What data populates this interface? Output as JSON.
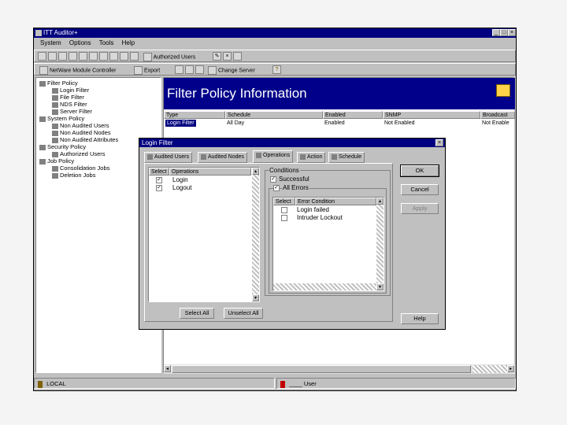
{
  "app": {
    "title": "ITT Auditor+"
  },
  "menu": [
    "System",
    "Options",
    "Tools",
    "Help"
  ],
  "toolbar": {
    "authorized_users": "Authorized Users",
    "netware_module_controller": "NetWare Module Controller",
    "export": "Export",
    "change_server": "Change Server"
  },
  "tree": {
    "items": [
      "Filter Policy",
      "Login Filter",
      "File Filter",
      "NDS Filter",
      "Server Filter",
      "System Policy",
      "Non Audited Users",
      "Non Audited Nodes",
      "Non Audited Attributes",
      "Security Policy",
      "Authorized Users",
      "Job Policy",
      "Consolidation Jobs",
      "Deletion Jobs"
    ]
  },
  "main": {
    "banner": "Filter Policy Information",
    "columns": [
      "Type",
      "Schedule",
      "Enabled",
      "SNMP",
      "Broadcast"
    ],
    "row": [
      "Login Filter",
      "All Day",
      "Enabled",
      "Not Enabled",
      "Not Enable"
    ]
  },
  "status": {
    "server": "LOCAL",
    "user": "____ User"
  },
  "dialog": {
    "title": "Login Filter",
    "tabs": [
      "Audited Users",
      "Audited Nodes",
      "Operations",
      "Action",
      "Schedule"
    ],
    "operations": {
      "headers": [
        "Select",
        "Operations"
      ],
      "items": [
        {
          "label": "Login",
          "checked": true
        },
        {
          "label": "Logout",
          "checked": true
        }
      ]
    },
    "conditions": {
      "group_label": "Conditions",
      "successful": "Successful",
      "successful_checked": true,
      "all_errors": "All Errors",
      "all_errors_checked": true,
      "headers": [
        "Select",
        "Error Condition"
      ],
      "items": [
        {
          "label": "Login failed",
          "checked": false
        },
        {
          "label": "Intruder Lockout",
          "checked": false
        }
      ]
    },
    "buttons": {
      "select_all": "Select All",
      "unselect_all": "Unselect All",
      "ok": "OK",
      "cancel": "Cancel",
      "apply": "Apply",
      "help": "Help"
    }
  }
}
